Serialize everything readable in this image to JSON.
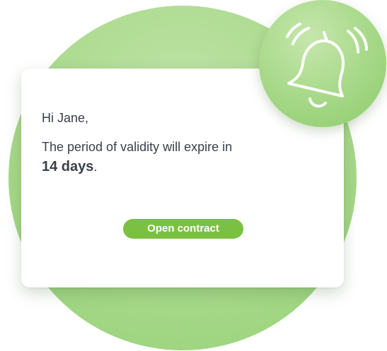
{
  "notification": {
    "greeting": "Hi Jane,",
    "message_prefix": "The period of validity will expire in",
    "highlight": "14 days",
    "message_suffix": ".",
    "button_label": "Open contract"
  },
  "icons": {
    "bell": "bell-icon"
  },
  "colors": {
    "accent": "#7ac142",
    "background_circle": "#a9d98b",
    "text": "#3b3f4a",
    "card": "#ffffff"
  }
}
